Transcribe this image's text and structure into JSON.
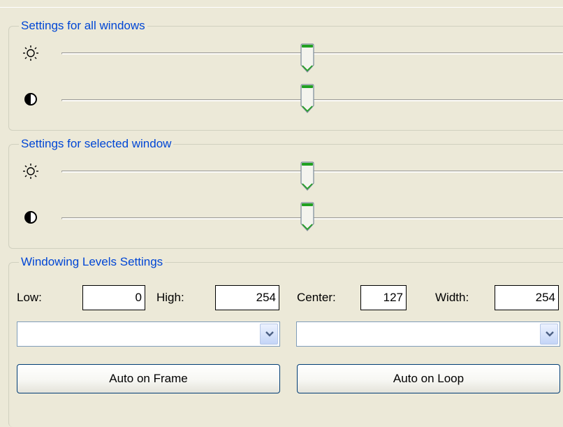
{
  "all_windows": {
    "title": "Settings for all windows",
    "brightness": {
      "icon": "sun-icon",
      "level_percent": 49
    },
    "contrast": {
      "icon": "contrast-icon",
      "level_percent": 49
    }
  },
  "selected_window": {
    "title": "Settings for selected window",
    "brightness": {
      "icon": "sun-icon",
      "level_percent": 49
    },
    "contrast": {
      "icon": "contrast-icon",
      "level_percent": 49
    }
  },
  "windowing": {
    "title": "Windowing Levels Settings",
    "low_label": "Low:",
    "low_value": "0",
    "high_label": "High:",
    "high_value": "254",
    "center_label": "Center:",
    "center_value": "127",
    "width_label": "Width:",
    "width_value": "254",
    "combo_left_value": "",
    "combo_right_value": "",
    "auto_frame_label": "Auto on Frame",
    "auto_loop_label": "Auto on Loop"
  },
  "colors": {
    "background": "#ece9d8",
    "group_title": "#0046d5",
    "thumb_accent": "#21a121",
    "button_border": "#003c74"
  }
}
